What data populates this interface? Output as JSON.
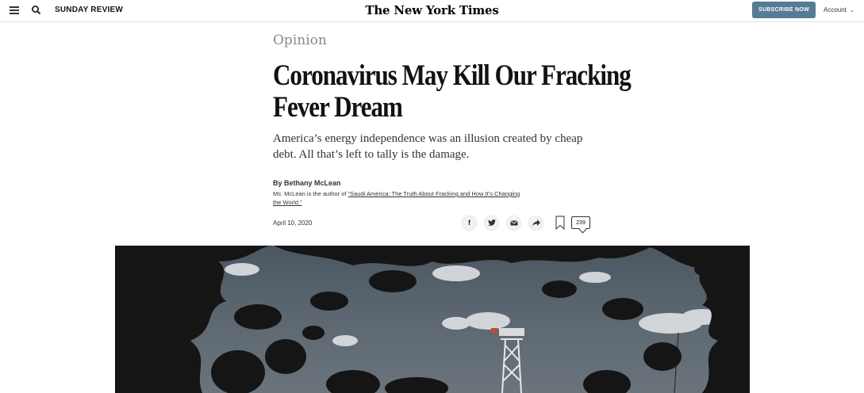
{
  "header": {
    "section_label": "SUNDAY REVIEW",
    "logo_text": "The New York Times",
    "subscribe_label": "SUBSCRIBE NOW",
    "account_label": "Account"
  },
  "article": {
    "kicker": "Opinion",
    "headline": "Coronavirus May Kill Our Fracking Fever Dream",
    "summary": "America’s energy independence was an illusion created by cheap debt. All that’s left to tally is the damage.",
    "byline": "By Bethany McLean",
    "bio_prefix": "Ms. McLean is the author of ",
    "bio_link": "“Saudi America: The Truth About Fracking and How It’s Changing the World.”",
    "date": "April 10, 2020"
  },
  "share": {
    "facebook_glyph": "f",
    "comment_count": "239"
  },
  "icons": [
    "menu-icon",
    "search-icon",
    "facebook-icon",
    "twitter-icon",
    "email-icon",
    "share-icon",
    "bookmark-icon",
    "comment-icon"
  ]
}
